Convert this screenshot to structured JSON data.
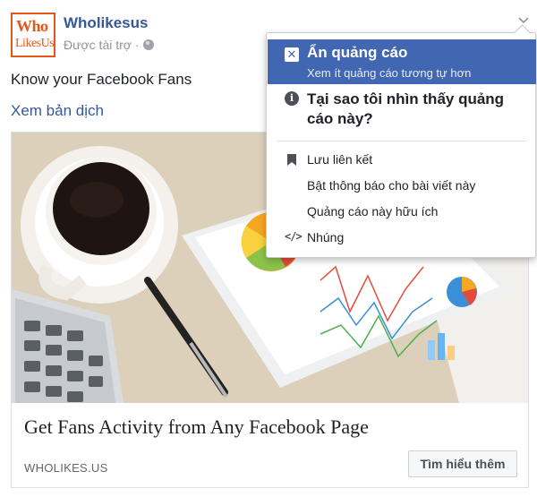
{
  "post": {
    "page_name": "Wholikesus",
    "sponsored": "Được tài trợ ·",
    "message": "Know your Facebook Fans",
    "translate_link": "Xem bản dịch",
    "logo": {
      "line1": "Who",
      "line2": "LikesUs",
      "color": "#e4571a"
    },
    "icons": {
      "privacy": "globe-icon",
      "menu": "chevron-down-icon"
    }
  },
  "card": {
    "image_alt": "Coffee cup, calculator, pen and tablet with charts",
    "title": "Get Fans Activity from Any Facebook Page",
    "domain": "WHOLIKES.US",
    "cta_button": "Tìm hiểu thêm"
  },
  "menu": {
    "hide": {
      "title": "Ẩn quảng cáo",
      "subtitle": "Xem ít quảng cáo tương tự hơn",
      "icon": "close-icon"
    },
    "why": {
      "title": "Tại sao tôi nhìn thấy quảng cáo này?",
      "icon": "info-icon"
    },
    "items": [
      {
        "label": "Lưu liên kết",
        "icon": "bookmark-icon"
      },
      {
        "label": "Bật thông báo cho bài viết này",
        "icon": ""
      },
      {
        "label": "Quảng cáo này hữu ích",
        "icon": ""
      },
      {
        "label": "Nhúng",
        "icon": "code-icon"
      }
    ]
  },
  "colors": {
    "link": "#365899",
    "accent": "#4267b2",
    "muted": "#90949c"
  }
}
